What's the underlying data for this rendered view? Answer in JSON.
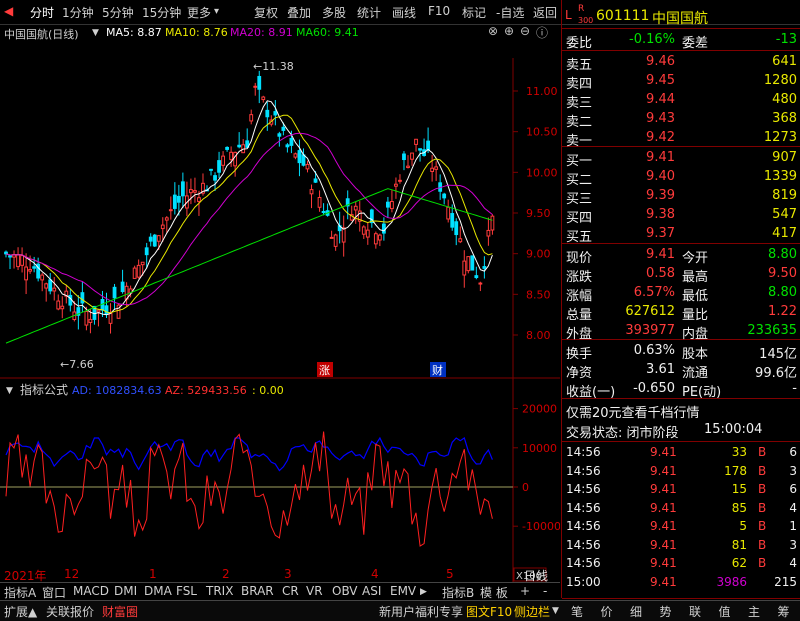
{
  "toolbar": {
    "tabs": [
      "分时",
      "1分钟",
      "5分钟",
      "15分钟",
      "更多",
      "复权",
      "叠加",
      "多股",
      "统计",
      "画线",
      "F10",
      "标记",
      "-自选",
      "返回"
    ],
    "more_arrow": "▾"
  },
  "chart_header": {
    "stock_label": "中国国航(日线)",
    "ma5": "MA5: 8.87",
    "ma10": "MA10: 8.76",
    "ma20": "MA20: 8.91",
    "ma60": "MA60: 9.41"
  },
  "indicator_header": {
    "name": "指标公式",
    "ad": "AD: 1082834.63",
    "az": "AZ: 529433.56",
    "extra": ": 0.00"
  },
  "annotations": {
    "high_label": "11.38",
    "low_label": "7.66",
    "zhang": "涨",
    "cai": "财",
    "x100": "X100"
  },
  "price_axis": [
    "11.00",
    "10.50",
    "10.00",
    "9.50",
    "9.00",
    "8.50",
    "8.00"
  ],
  "ind_axis": [
    "20000",
    "10000",
    "0",
    "-10000"
  ],
  "date_bar": {
    "year": "2021年",
    "months": [
      "12",
      "1",
      "2",
      "3",
      "4",
      "5"
    ],
    "period": "日线"
  },
  "indicator_tabs": [
    "指标A",
    "窗口",
    "MACD",
    "DMI",
    "DMA",
    "FSL",
    "TRIX",
    "BRAR",
    "CR",
    "VR",
    "OBV",
    "ASI",
    "EMV",
    "指标B",
    "模 板",
    "+",
    "-"
  ],
  "ext_tabs": [
    "扩展▲",
    "关联报价",
    "财富圈",
    "新用户福利专享",
    "图文F10",
    "侧边栏"
  ],
  "quote": {
    "code_prefix": "L",
    "r_badge": "R",
    "badge_num": "300",
    "code": "601111",
    "name": "中国国航",
    "weibi_label": "委比",
    "weibi": "-0.16%",
    "weicha_label": "委差",
    "weicha": "-13",
    "asks": [
      {
        "label": "卖五",
        "price": "9.46",
        "vol": "641"
      },
      {
        "label": "卖四",
        "price": "9.45",
        "vol": "1280"
      },
      {
        "label": "卖三",
        "price": "9.44",
        "vol": "480"
      },
      {
        "label": "卖二",
        "price": "9.43",
        "vol": "368"
      },
      {
        "label": "卖一",
        "price": "9.42",
        "vol": "1273"
      }
    ],
    "bids": [
      {
        "label": "买一",
        "price": "9.41",
        "vol": "907"
      },
      {
        "label": "买二",
        "price": "9.40",
        "vol": "1339"
      },
      {
        "label": "买三",
        "price": "9.39",
        "vol": "819"
      },
      {
        "label": "买四",
        "price": "9.38",
        "vol": "547"
      },
      {
        "label": "买五",
        "price": "9.37",
        "vol": "417"
      }
    ],
    "stats": [
      {
        "l1": "现价",
        "v1": "9.41",
        "c1": "red",
        "l2": "今开",
        "v2": "8.80",
        "c2": "grn"
      },
      {
        "l1": "涨跌",
        "v1": "0.58",
        "c1": "red",
        "l2": "最高",
        "v2": "9.50",
        "c2": "red"
      },
      {
        "l1": "涨幅",
        "v1": "6.57%",
        "c1": "red",
        "l2": "最低",
        "v2": "8.80",
        "c2": "grn"
      },
      {
        "l1": "总量",
        "v1": "627612",
        "c1": "yel",
        "l2": "量比",
        "v2": "1.22",
        "c2": "red"
      },
      {
        "l1": "外盘",
        "v1": "393977",
        "c1": "red",
        "l2": "内盘",
        "v2": "233635",
        "c2": "grn"
      }
    ],
    "stats2": [
      {
        "l1": "换手",
        "v1": "0.63%",
        "l2": "股本",
        "v2": "145亿"
      },
      {
        "l1": "净资",
        "v1": "3.61",
        "l2": "流通",
        "v2": "99.6亿"
      },
      {
        "l1": "收益(一)",
        "v1": "-0.650",
        "l2": "PE(动)",
        "v2": "-"
      }
    ],
    "promo": "仅需20元查看千档行情",
    "trade_status": "交易状态: 闭市阶段",
    "trade_time": "15:00:04",
    "ticks": [
      {
        "t": "14:56",
        "p": "9.41",
        "v": "33",
        "s": "B",
        "n": "6"
      },
      {
        "t": "14:56",
        "p": "9.41",
        "v": "178",
        "s": "B",
        "n": "3"
      },
      {
        "t": "14:56",
        "p": "9.41",
        "v": "15",
        "s": "B",
        "n": "6"
      },
      {
        "t": "14:56",
        "p": "9.41",
        "v": "85",
        "s": "B",
        "n": "4"
      },
      {
        "t": "14:56",
        "p": "9.41",
        "v": "5",
        "s": "B",
        "n": "1"
      },
      {
        "t": "14:56",
        "p": "9.41",
        "v": "81",
        "s": "B",
        "n": "3"
      },
      {
        "t": "14:56",
        "p": "9.41",
        "v": "62",
        "s": "B",
        "n": "4"
      },
      {
        "t": "15:00",
        "p": "9.41",
        "v": "3986",
        "s": "",
        "n": "215"
      }
    ],
    "bottom_tabs": [
      "笔",
      "价",
      "细",
      "势",
      "联",
      "值",
      "主",
      "筹"
    ]
  },
  "colors": {
    "up": "#ff3b3b",
    "down": "#00e0ff",
    "ma5": "#ffffff",
    "ma10": "#e8e800",
    "ma20": "#d000d0",
    "ma60": "#00e000",
    "ad": "#0000ff",
    "az": "#ff2020",
    "frame": "#800000"
  }
}
